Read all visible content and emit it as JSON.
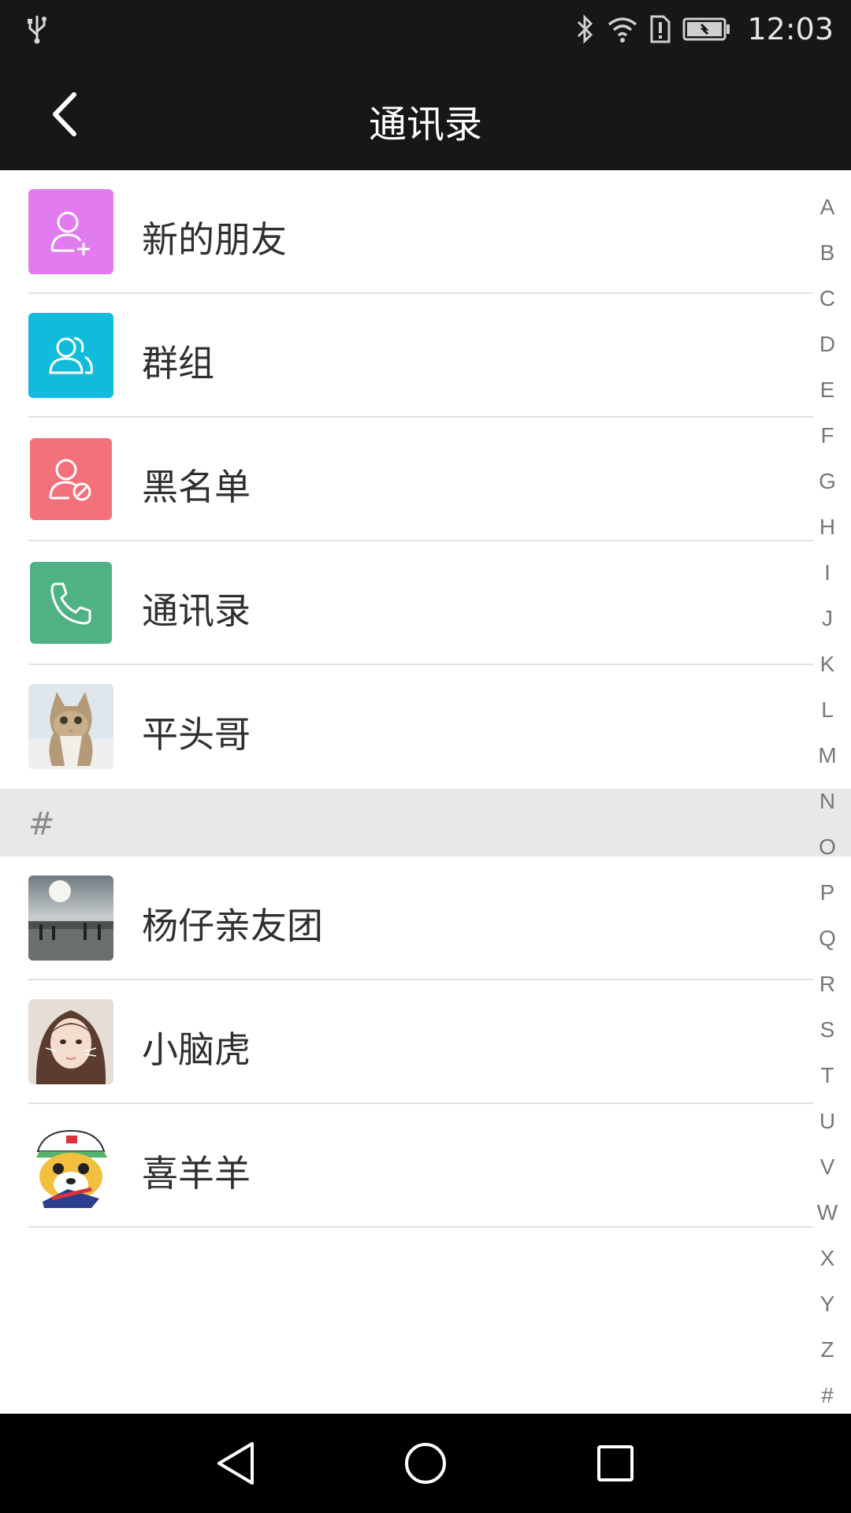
{
  "status_bar": {
    "time": "12:03",
    "icons": [
      "usb-icon",
      "bluetooth-icon",
      "wifi-icon",
      "sim-alert-icon",
      "battery-icon"
    ]
  },
  "header": {
    "title": "通讯录",
    "back_icon": "chevron-left-icon"
  },
  "function_items": [
    {
      "label": "新的朋友",
      "icon": "add-user-icon",
      "color": "#E27BF0"
    },
    {
      "label": "群组",
      "icon": "group-icon",
      "color": "#11BCDB"
    },
    {
      "label": "黑名单",
      "icon": "blocked-user-icon",
      "color": "#F4717B"
    },
    {
      "label": "通讯录",
      "icon": "phone-icon",
      "color": "#4FB282"
    },
    {
      "label": "平头哥",
      "icon": "cat-avatar"
    }
  ],
  "section": {
    "header": "#",
    "contacts": [
      {
        "label": "杨仔亲友团",
        "icon": "landscape-avatar"
      },
      {
        "label": "小脑虎",
        "icon": "girl-avatar"
      },
      {
        "label": "喜羊羊",
        "icon": "cartoon-dog-avatar"
      }
    ]
  },
  "index_letters": [
    "A",
    "B",
    "C",
    "D",
    "E",
    "F",
    "G",
    "H",
    "I",
    "J",
    "K",
    "L",
    "M",
    "N",
    "O",
    "P",
    "Q",
    "R",
    "S",
    "T",
    "U",
    "V",
    "W",
    "X",
    "Y",
    "Z",
    "#"
  ],
  "nav_bar": {
    "buttons": [
      "back-triangle-icon",
      "home-circle-icon",
      "recents-square-icon"
    ]
  }
}
